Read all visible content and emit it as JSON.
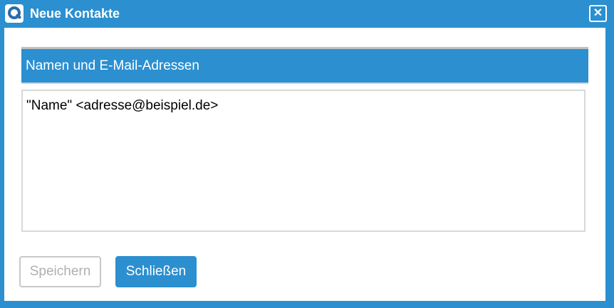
{
  "window": {
    "title": "Neue Kontakte",
    "app_icon": "q-logo-icon",
    "close_icon": "close-icon"
  },
  "section": {
    "header": "Namen und E-Mail-Adressen"
  },
  "input": {
    "value": "\"Name\" <adresse@beispiel.de>"
  },
  "buttons": {
    "save_label": "Speichern",
    "close_label": "Schließen"
  },
  "colors": {
    "accent": "#2b8fd0",
    "disabled_text": "#b0b0b0"
  }
}
